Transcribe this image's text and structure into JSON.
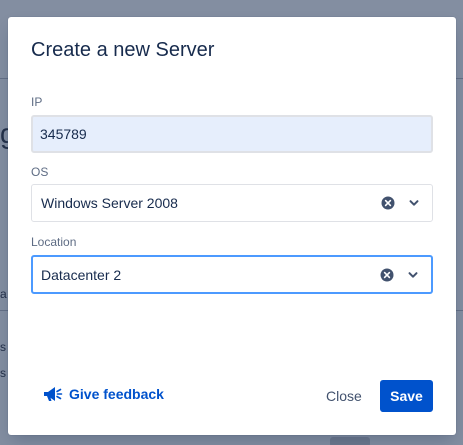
{
  "dialog": {
    "title": "Create a new Server"
  },
  "form": {
    "ip": {
      "label": "IP",
      "value": "345789"
    },
    "os": {
      "label": "OS",
      "value": "Windows Server 2008"
    },
    "location": {
      "label": "Location",
      "value": "Datacenter 2"
    }
  },
  "footer": {
    "feedback_label": "Give feedback",
    "close_label": "Close",
    "save_label": "Save"
  },
  "colors": {
    "primary": "#0052cc",
    "focus_border": "#4c9aff",
    "autofill_bg": "#e6eefc",
    "overlay": "#8c8f96"
  },
  "icons": {
    "feedback": "megaphone-icon",
    "clear": "clear-circle-icon",
    "dropdown": "chevron-down-icon"
  }
}
